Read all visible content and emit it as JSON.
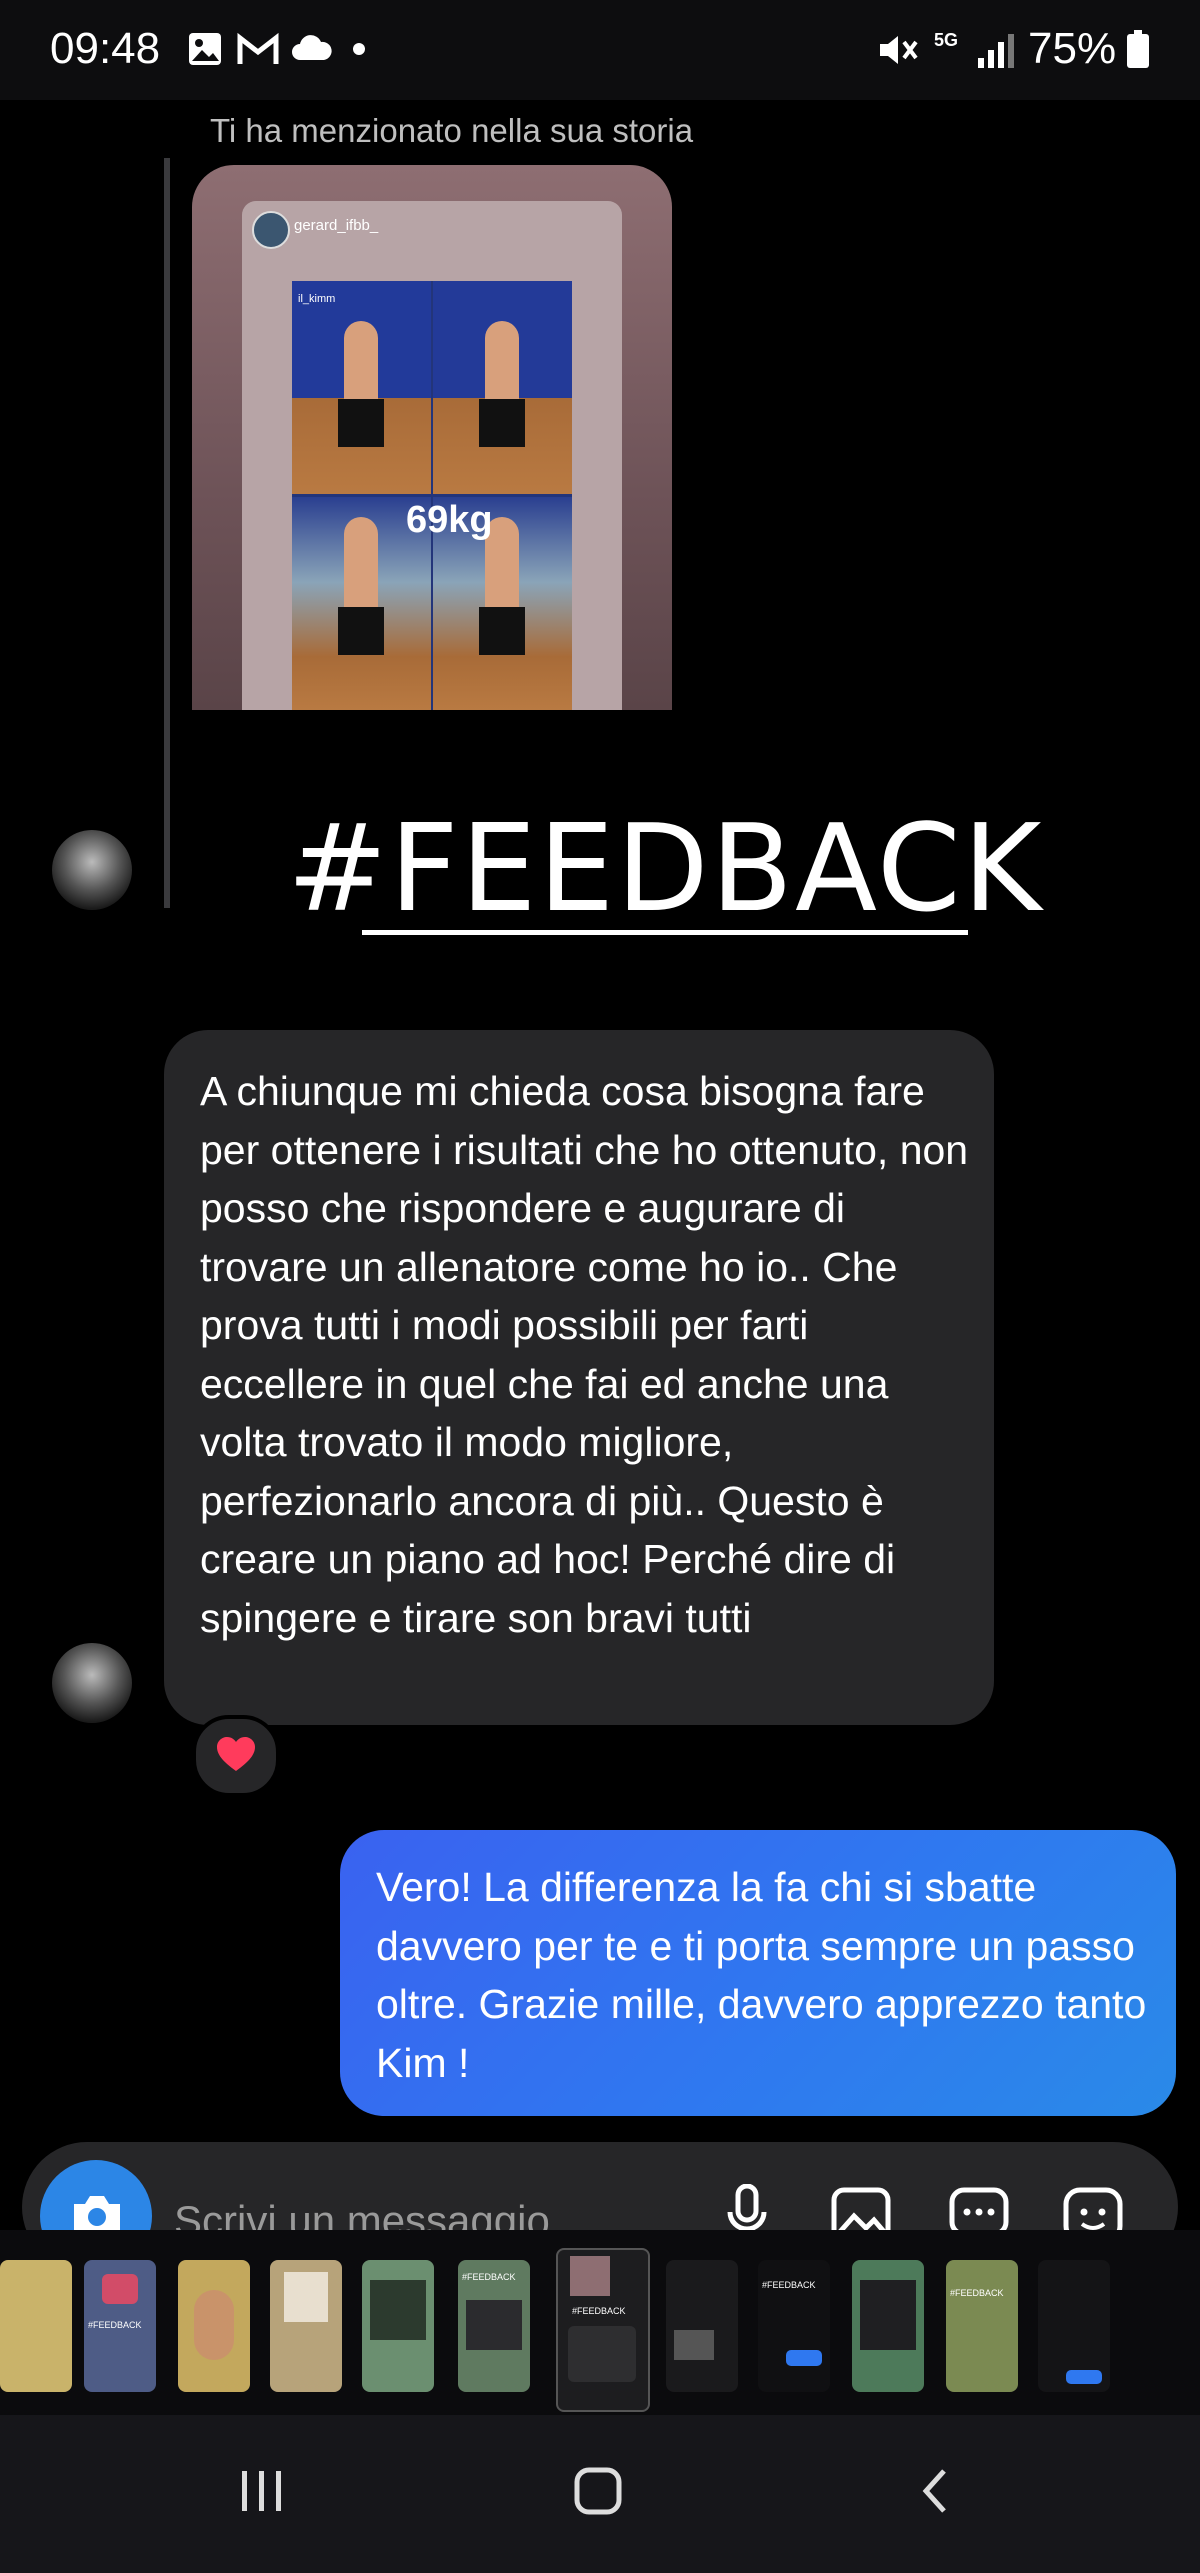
{
  "status_bar": {
    "time": "09:48",
    "battery": "75%",
    "network": "5G",
    "icons": [
      "gallery-icon",
      "gmail-icon",
      "cloud-icon",
      "dot-icon",
      "mute-icon",
      "signal-icon",
      "battery-icon"
    ]
  },
  "conversation": {
    "mention_text": "Ti ha menzionato nella sua storia",
    "story": {
      "username": "gerard_ifbb_",
      "tag": "il_kimm",
      "weight": "69kg"
    },
    "feedback_title": "#FEEDBACK",
    "incoming_message": "A chiunque mi chieda cosa bisogna fare per ottenere i risultati che ho ottenuto, non posso che rispondere e augurare di trovare un allenatore come ho io.. Che prova tutti i modi possibili per farti eccellere in quel che fai ed anche una volta trovato il modo migliore, perfezionarlo ancora di più.. Questo è creare un piano ad hoc! Perché dire di spingere e tirare son bravi tutti",
    "reaction": "heart",
    "outgoing_message": "Vero! La differenza la fa chi si sbatte davvero per te e ti porta sempre un passo oltre. Grazie mille, davvero apprezzo tanto Kim !"
  },
  "composer": {
    "placeholder": "Scrivi un messaggio..."
  },
  "thumbnails": {
    "labels": [
      "#FEEDBACK",
      "#FEEDBACK",
      "#FEEDBACK",
      "#FEEDBACK",
      "#FEEDBACK"
    ],
    "colors": [
      "#c9b36a",
      "#4e5c86",
      "#c3a85d",
      "#b7a37a",
      "#6b8f70",
      "#5f7a60",
      "#1d1d1f",
      "#1a1a1c",
      "#101012",
      "#4d7a5a",
      "#7b8a52",
      "#141416"
    ]
  },
  "colors": {
    "outgoing_bubble": "#2f78f0",
    "incoming_bubble": "#262628",
    "camera_button": "#2c86e6",
    "reaction_heart": "#ff3b5c"
  }
}
